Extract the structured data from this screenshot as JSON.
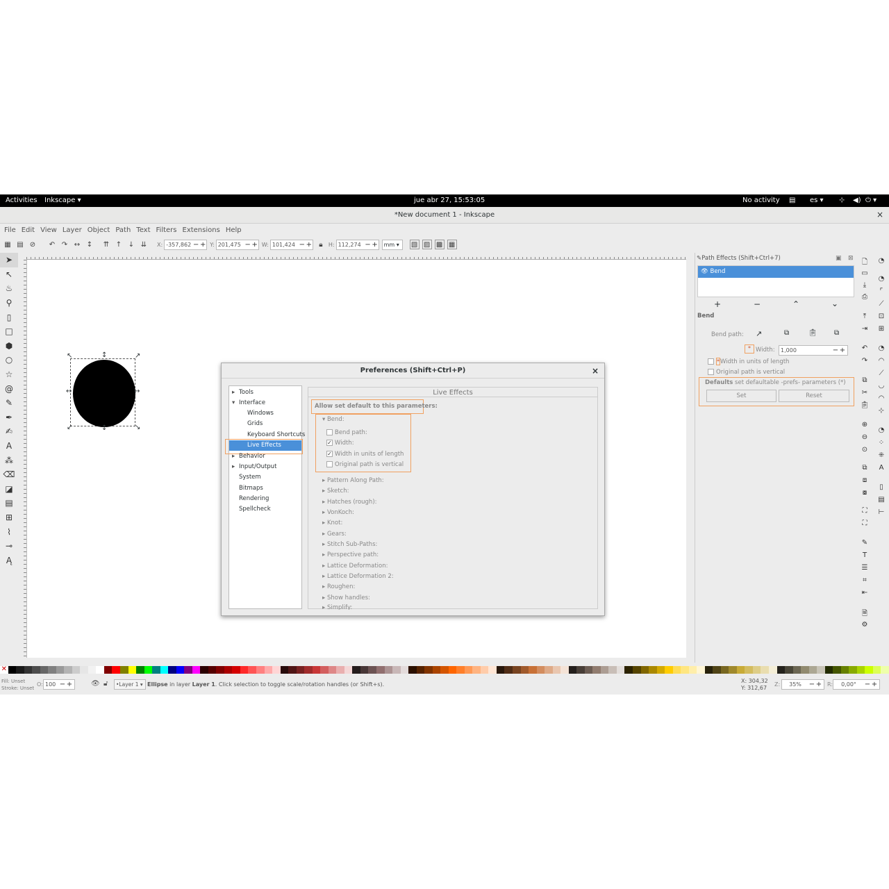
{
  "topbar": {
    "activities": "Activities",
    "app": "Inkscape ▾",
    "clock": "jue abr 27, 15:53:05",
    "status": "No activity",
    "lang": "es ▾"
  },
  "window": {
    "title": "*New document 1 - Inkscape",
    "close": "×"
  },
  "menu": [
    "File",
    "Edit",
    "View",
    "Layer",
    "Object",
    "Path",
    "Text",
    "Filters",
    "Extensions",
    "Help"
  ],
  "toolbar": {
    "x_label": "X:",
    "x": "-357,862",
    "y_label": "Y:",
    "y": "201,475",
    "w_label": "W:",
    "w": "101,424",
    "h_label": "H:",
    "h": "112,274",
    "unit": "mm ▾"
  },
  "dialog": {
    "title": "Preferences (Shift+Ctrl+P)",
    "close": "×",
    "tree": [
      "Tools",
      "Interface",
      "Windows",
      "Grids",
      "Keyboard Shortcuts",
      "Live Effects",
      "Behavior",
      "Input/Output",
      "System",
      "Bitmaps",
      "Rendering",
      "Spellcheck"
    ],
    "panel_title": "Live Effects",
    "allow_label": "Allow set default to this parameters:",
    "bend_label": "Bend:",
    "bend_params": [
      {
        "label": "Bend path:",
        "checked": false
      },
      {
        "label": "Width:",
        "checked": true
      },
      {
        "label": "Width in units of length",
        "checked": true
      },
      {
        "label": "Original path is vertical",
        "checked": false
      }
    ],
    "effects": [
      "Pattern Along Path:",
      "Sketch:",
      "Hatches (rough):",
      "VonKoch:",
      "Knot:",
      "Gears:",
      "Stitch Sub-Paths:",
      "Perspective path:",
      "Lattice Deformation:",
      "Lattice Deformation 2:",
      "Roughen:",
      "Show handles:",
      "Simplify:"
    ]
  },
  "path_effects": {
    "title": "Path Effects  (Shift+Ctrl+7)",
    "item": "Bend",
    "section": "Bend",
    "bend_path_label": "Bend path:",
    "width_label": "Width:",
    "width_value": "1,000",
    "units_label": "Width in units of length",
    "vertical_label": "Original path is vertical",
    "defaults_bold": "Defaults",
    "defaults_text": "set defaultable -prefs- parameters (*)",
    "set": "Set",
    "reset": "Reset",
    "asterisk": "*"
  },
  "status": {
    "fill_label": "Fill:",
    "fill": "Unset",
    "stroke_label": "Stroke:",
    "stroke": "Unset",
    "opacity_label": "O:",
    "opacity": "100",
    "layer": "•Layer 1 ▾",
    "msg_bold": "Ellipse",
    "msg1": " in layer ",
    "msg_layer": "Layer 1",
    "msg2": ". Click selection to toggle scale/rotation handles (or Shift+s).",
    "coord_x": "X: 304,32",
    "coord_y": "Y: 312,67",
    "zoom_label": "Z:",
    "zoom": "35%",
    "rot_label": "R:",
    "rot": "0,00°"
  },
  "colors": {
    "selection": "#4a90d9",
    "highlight": "#f0a060"
  }
}
